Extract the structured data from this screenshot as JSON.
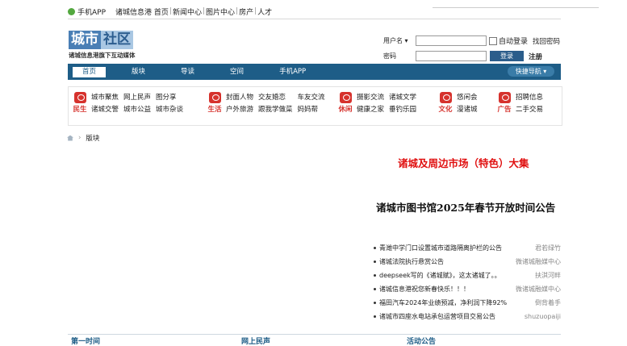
{
  "topbar": {
    "items": [
      "手机APP",
      "诸城信息港 首页",
      "新闻中心",
      "图片中心",
      "房产",
      "人才"
    ]
  },
  "logo": {
    "part1": "城市",
    "part2": "社区",
    "slogan": "诸城信息港旗下互动媒体"
  },
  "login": {
    "username_label": "用户名 ▾",
    "password_label": "密码",
    "auto_login": "自动登录",
    "forgot": "找回密码",
    "login_button": "登录",
    "register": "注册"
  },
  "nav": {
    "items": [
      "首页",
      "版块",
      "导读",
      "空间",
      "手机APP"
    ],
    "quick": "快捷导航 ▾"
  },
  "categories": [
    {
      "name": "民生",
      "links": [
        "城市聚焦",
        "网上民声",
        "图分享",
        "诸城交警",
        "城市公益",
        "城市杂谈"
      ]
    },
    {
      "name": "生活",
      "links": [
        "封面人物",
        "交友婚恋",
        "车友交流",
        "户外旅游",
        "跟我学做菜",
        "妈妈帮"
      ]
    },
    {
      "name": "休闲",
      "links": [
        "摄影交流",
        "诸城文学",
        "健康之家",
        "垂钓乐园"
      ]
    },
    {
      "name": "文化",
      "links": [
        "悠闲会",
        "漫诸城"
      ]
    },
    {
      "name": "广告",
      "links": [
        "招聘信息",
        "二手交易"
      ]
    }
  ],
  "breadcrumb": {
    "current": "版块"
  },
  "headlines": {
    "h1": "诸城及周边市场（特色）大集",
    "h2": "诸城市图书馆2025年春节开放时间公告"
  },
  "news": [
    {
      "title": "青潍中学门口设置城市道路隔离护栏的公告",
      "author": "君若绿竹"
    },
    {
      "title": "诸城法院执行悬赏公告",
      "author": "微诸城融媒中心"
    },
    {
      "title": "deepseek写的《诸城赋》，这太诸城了。。",
      "author": "扶淇河畔"
    },
    {
      "title": "诸城信息港祝您新春快乐！！！",
      "author": "微诸城融媒中心"
    },
    {
      "title": "福田汽车2024年业绩预减，净利润下降92%",
      "author": "倒背着手"
    },
    {
      "title": "诸城市四座水电站承包运营项目交易公告",
      "author": "shuzuopaiji"
    }
  ],
  "bottom_tabs": [
    "第一时间",
    "网上民声",
    "活动公告"
  ],
  "colors": {
    "nav_bg": "#1e5d87",
    "accent_red": "#e01010",
    "category_red": "#d6322d"
  }
}
